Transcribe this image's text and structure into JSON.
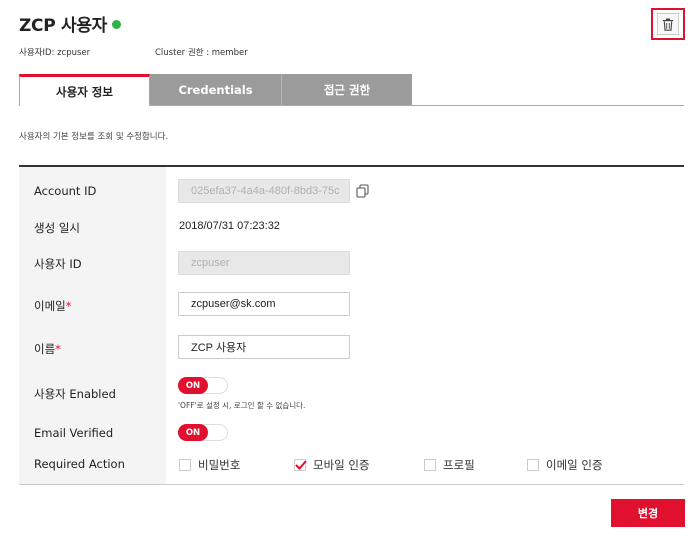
{
  "header": {
    "title": "ZCP 사용자",
    "status_color": "#2eb24a",
    "user_id_meta": "사용자ID: zcpuser",
    "cluster_role_meta": "Cluster 권한 : member",
    "delete_icon": "trash-icon"
  },
  "tabs": [
    {
      "label": "사용자 정보",
      "active": true
    },
    {
      "label": "Credentials",
      "active": false
    },
    {
      "label": "접근 권한",
      "active": false
    }
  ],
  "description": "사용자의 기본 정보를 조회 및 수정합니다.",
  "form": {
    "account_id": {
      "label": "Account ID",
      "value": "025efa37-4a4a-480f-8bd3-75c",
      "copy_icon": "copy-icon"
    },
    "created_at": {
      "label": "생성 일시",
      "value": "2018/07/31 07:23:32"
    },
    "username": {
      "label": "사용자 ID",
      "value": "zcpuser"
    },
    "email": {
      "label": "이메일",
      "required_mark": "*",
      "value": "zcpuser@sk.com"
    },
    "name": {
      "label": "이름",
      "required_mark": "*",
      "value": "ZCP 사용자"
    },
    "enabled": {
      "label": "사용자 Enabled",
      "toggle": "ON",
      "state": true,
      "hint": "'OFF'로 설정 시, 로그인 할 수 없습니다."
    },
    "email_verified": {
      "label": "Email Verified",
      "toggle": "ON",
      "state": true
    },
    "required_action": {
      "label": "Required Action",
      "options": [
        {
          "label": "비밀번호",
          "checked": false
        },
        {
          "label": "모바일 인증",
          "checked": true
        },
        {
          "label": "프로필",
          "checked": false
        },
        {
          "label": "이메일 인증",
          "checked": false
        }
      ]
    }
  },
  "submit_label": "변경",
  "colors": {
    "accent": "#e0102e",
    "tab_inactive": "#9b9b9b"
  }
}
